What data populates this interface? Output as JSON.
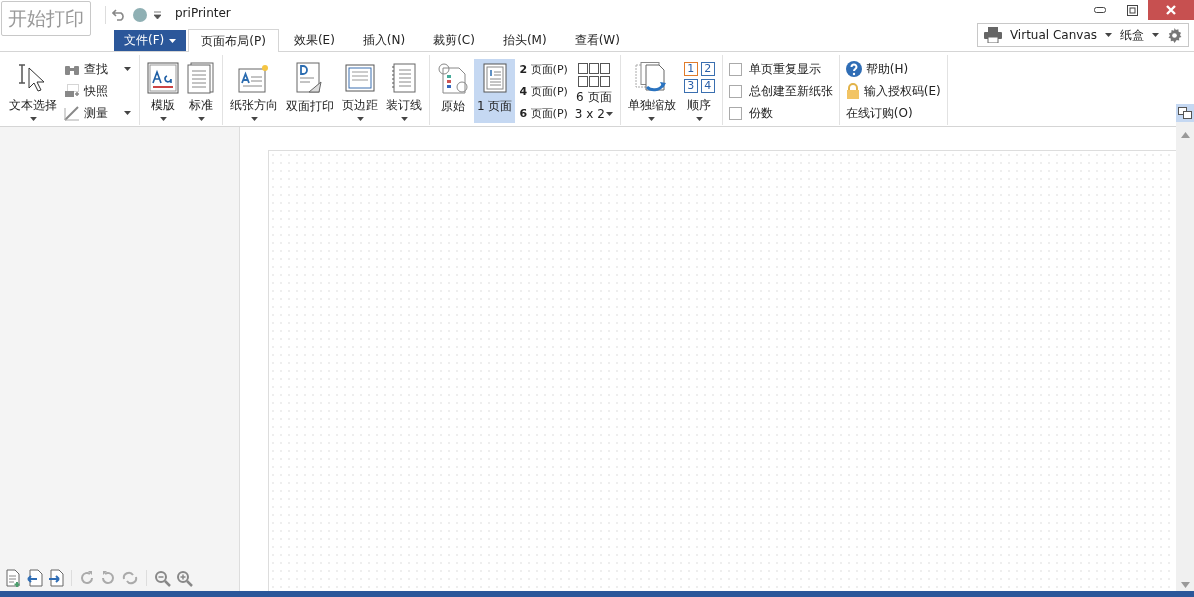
{
  "start_button": "开始打印",
  "window": {
    "title": "priPrinter"
  },
  "file_menu": {
    "label": "文件(F)"
  },
  "tabs": [
    {
      "label": "页面布局(P)",
      "selected": true
    },
    {
      "label": "效果(E)",
      "selected": false
    },
    {
      "label": "插入(N)",
      "selected": false
    },
    {
      "label": "裁剪(C)",
      "selected": false
    },
    {
      "label": "抬头(M)",
      "selected": false
    },
    {
      "label": "查看(W)",
      "selected": false
    }
  ],
  "printer": {
    "name": "Virtual Canvas",
    "tray": "纸盒"
  },
  "ribbon_groups": [
    {
      "items": [
        {
          "kind": "large",
          "label": "文本选择",
          "dropdown": true
        },
        {
          "kind": "small",
          "label": "查找",
          "dropdown": true
        },
        {
          "kind": "small",
          "label": "快照",
          "dropdown": false
        },
        {
          "kind": "small",
          "label": "测量",
          "dropdown": true
        }
      ]
    },
    {
      "items": [
        {
          "kind": "large",
          "label": "模版",
          "dropdown": true
        },
        {
          "kind": "large",
          "label": "标准",
          "dropdown": true
        }
      ]
    },
    {
      "items": [
        {
          "kind": "large",
          "label": "纸张方向",
          "dropdown": true
        },
        {
          "kind": "large",
          "label": "双面打印",
          "dropdown": false
        },
        {
          "kind": "large",
          "label": "页边距",
          "dropdown": true
        },
        {
          "kind": "large",
          "label": "装订线",
          "dropdown": true
        }
      ]
    },
    {
      "items": [
        {
          "kind": "large",
          "label": "原始",
          "dropdown": false,
          "selected": false
        },
        {
          "kind": "large",
          "label": "1 页面",
          "dropdown": false,
          "selected": true
        },
        {
          "kind": "text",
          "label": "**2** 页面(P)",
          "selected": false
        },
        {
          "kind": "text",
          "label": "**4** 页面(P)",
          "selected": false
        },
        {
          "kind": "text",
          "label": "**6** 页面(P)",
          "selected": false
        },
        {
          "kind": "grid",
          "label": "6 页面",
          "sublabel": "3 x 2",
          "selected": false
        }
      ]
    },
    {
      "items": [
        {
          "kind": "large",
          "label": "单独缩放",
          "dropdown": true
        },
        {
          "kind": "order",
          "label": "顺序",
          "digits": [
            "1",
            "2",
            "3",
            "4"
          ],
          "dropdown": true
        }
      ]
    },
    {
      "items": [
        {
          "kind": "check",
          "label": "单页重复显示",
          "checked": false
        },
        {
          "kind": "check",
          "label": "总创建至新纸张",
          "checked": false
        },
        {
          "kind": "check",
          "label": "份数",
          "checked": false
        }
      ]
    },
    {
      "items": [
        {
          "kind": "small",
          "label": "帮助(H)",
          "dropdown": false
        },
        {
          "kind": "small",
          "label": "输入授权码(E)",
          "dropdown": false
        },
        {
          "kind": "link",
          "label": "在线订购(O)"
        }
      ]
    }
  ]
}
